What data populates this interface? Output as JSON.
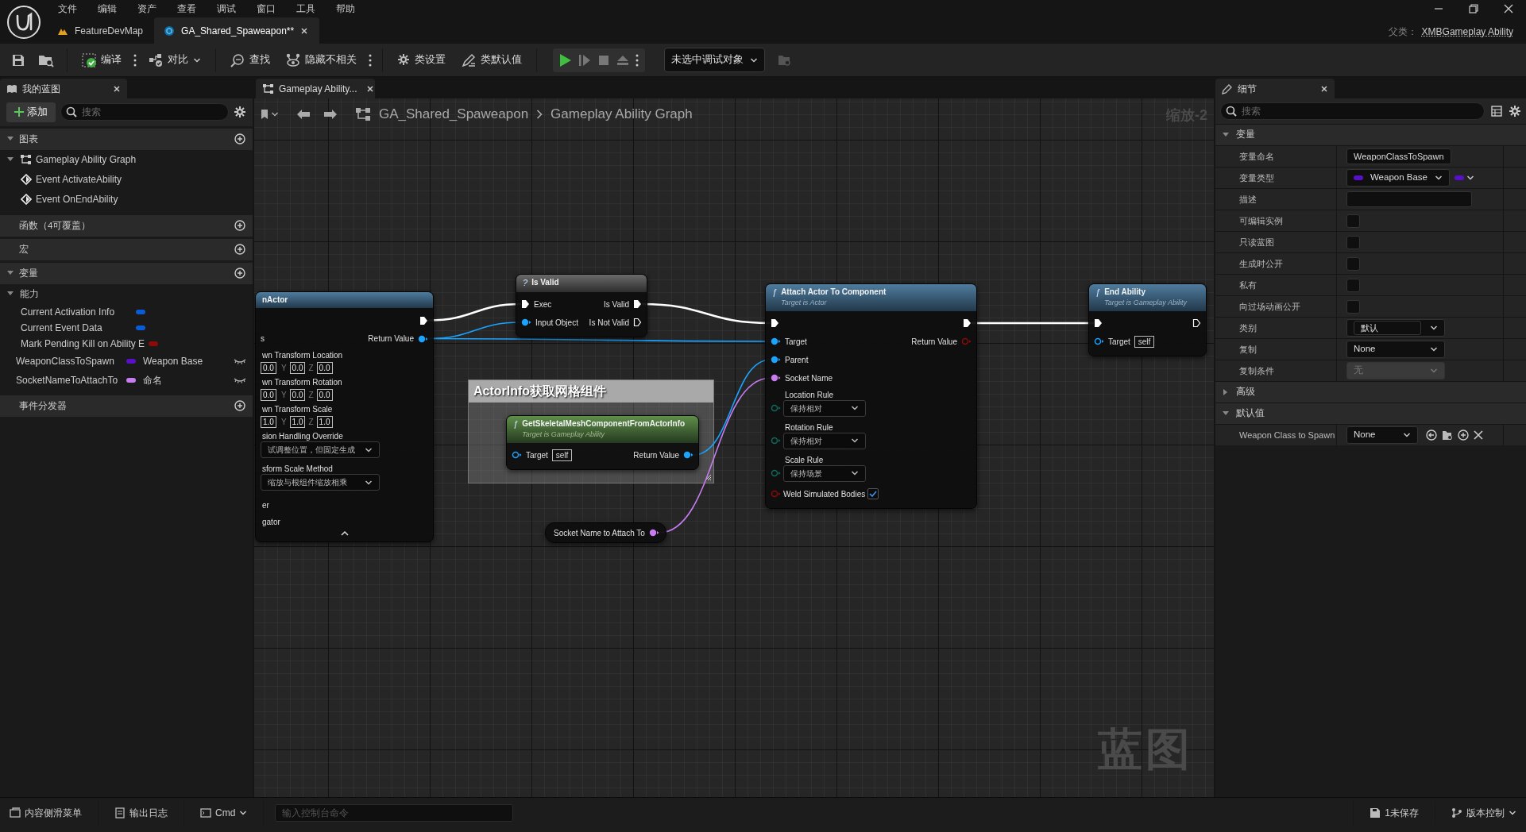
{
  "menu": [
    "文件",
    "编辑",
    "资产",
    "查看",
    "调试",
    "窗口",
    "工具",
    "帮助"
  ],
  "doc_tabs": [
    {
      "label": "FeatureDevMap",
      "selected": false
    },
    {
      "label": "GA_Shared_Spaweapon**",
      "selected": true
    }
  ],
  "parent_class": {
    "label": "父类：",
    "value": "XMBGameplay Ability"
  },
  "toolbar": [
    {
      "kind": "compile",
      "label": "编译"
    },
    {
      "kind": "diff",
      "label": "对比"
    },
    {
      "kind": "find",
      "label": "查找"
    },
    {
      "kind": "hide",
      "label": "隐藏不相关"
    },
    {
      "kind": "settings",
      "label": "类设置"
    },
    {
      "kind": "defaults",
      "label": "类默认值"
    }
  ],
  "debug_target": "未选中调试对象",
  "my_blueprint": {
    "tab": "我的蓝图",
    "add_button": "添加",
    "search_placeholder": "搜索",
    "sections": [
      {
        "title": "图表",
        "expanded": true,
        "items": [
          {
            "label": "Gameplay Ability Graph",
            "kind": "graph",
            "expanded": true,
            "children": [
              {
                "label": "Event ActivateAbility",
                "kind": "event"
              },
              {
                "label": "Event OnEndAbility",
                "kind": "event"
              }
            ]
          }
        ]
      },
      {
        "title": "函数（4可覆盖）"
      },
      {
        "title": "宏"
      },
      {
        "title": "变量",
        "expanded": true,
        "items": [
          {
            "label": "能力",
            "kind": "category",
            "expanded": true,
            "children": [
              {
                "label": "Current Activation Info",
                "kind": "variable",
                "color": "#0a5bd6"
              },
              {
                "label": "Current Event Data",
                "kind": "variable",
                "color": "#0a5bd6"
              },
              {
                "label": "Mark Pending Kill on Ability E",
                "kind": "variable",
                "color": "#8b0a0a"
              }
            ]
          },
          {
            "label": "WeaponClassToSpawn",
            "kind": "variable",
            "color": "#5a0fc8",
            "type": "Weapon Base",
            "exposed": false
          },
          {
            "label": "SocketNameToAttachTo",
            "kind": "variable",
            "color": "#c77df0",
            "type": "命名",
            "exposed": false
          }
        ]
      },
      {
        "title": "事件分发器"
      }
    ]
  },
  "graph": {
    "tab": "Gameplay Ability...",
    "breadcrumb": [
      "GA_Shared_Spaweapon",
      "Gameplay Ability Graph"
    ],
    "zoom": "缩放-2",
    "watermark": "蓝图",
    "nodes": [
      {
        "kind": "function",
        "title": "nActor",
        "collapsible": true,
        "rows": [
          {
            "kind": "pins",
            "out": {
              "kind": "exec",
              "connected": true
            }
          },
          {
            "kind": "pins",
            "in": {
              "label": "s"
            },
            "out": {
              "kind": "data",
              "label": "Return Value",
              "color": "#1aa3ff",
              "connected": true
            }
          },
          {
            "kind": "vector",
            "label": "wn Transform Location",
            "values": [
              {
                "value": "0.0"
              },
              {
                "axis": "Y",
                "value": "0.0"
              },
              {
                "axis": "Z",
                "value": "0.0"
              }
            ]
          },
          {
            "kind": "vector",
            "label": "wn Transform Rotation",
            "values": [
              {
                "value": "0.0"
              },
              {
                "axis": "Y",
                "value": "0.0"
              },
              {
                "axis": "Z",
                "value": "0.0"
              }
            ]
          },
          {
            "kind": "vector",
            "label": "wn Transform Scale",
            "values": [
              {
                "value": "1.0"
              },
              {
                "axis": "Y",
                "value": "1.0"
              },
              {
                "axis": "Z",
                "value": "1.0"
              }
            ]
          },
          {
            "kind": "enum",
            "label": "sion Handling Override",
            "value": "试调整位置，但固定生成"
          },
          {
            "kind": "enum",
            "label": "sform Scale Method",
            "value": "缩放与根组件缩放相乘"
          },
          {
            "kind": "text",
            "label": "er"
          },
          {
            "kind": "text",
            "label": "gator"
          }
        ]
      },
      {
        "kind": "macro",
        "glyph": "?",
        "title": "Is Valid",
        "rows": [
          {
            "kind": "pins",
            "in": {
              "kind": "exec",
              "label": "Exec",
              "connected": true
            },
            "out": {
              "kind": "exec",
              "label": "Is Valid",
              "connected": true
            }
          },
          {
            "kind": "pins",
            "in": {
              "kind": "data",
              "label": "Input Object",
              "color": "#1aa3ff",
              "connected": true
            },
            "out": {
              "kind": "exec",
              "label": "Is Not Valid",
              "connected": false
            }
          }
        ]
      },
      {
        "kind": "comment",
        "title": "ActorInfo获取网格组件"
      },
      {
        "kind": "pure",
        "glyph": "ƒ",
        "title": "GetSkeletalMeshComponentFromActorInfo",
        "subtitle": "Target is Gameplay Ability",
        "rows": [
          {
            "kind": "pins",
            "in": {
              "kind": "data",
              "label": "Target",
              "color": "#1aa3ff",
              "connected": false,
              "default": "self"
            },
            "out": {
              "kind": "data",
              "label": "Return Value",
              "color": "#1aa3ff",
              "connected": true
            }
          }
        ]
      },
      {
        "kind": "getter",
        "rows": [
          {
            "kind": "pins",
            "out": {
              "kind": "data",
              "label": "Socket Name to Attach To",
              "color": "#c77df0",
              "connected": true
            }
          }
        ]
      },
      {
        "kind": "function",
        "glyph": "ƒ",
        "title": "Attach Actor To Component",
        "subtitle": "Target is Actor",
        "rows": [
          {
            "kind": "pins",
            "in": {
              "kind": "exec",
              "connected": true
            },
            "out": {
              "kind": "exec",
              "connected": true
            }
          },
          {
            "kind": "pins",
            "in": {
              "kind": "data",
              "label": "Target",
              "color": "#1aa3ff",
              "connected": true
            },
            "out": {
              "kind": "data",
              "label": "Return Value",
              "color": "#8b0a0a",
              "connected": false
            }
          },
          {
            "kind": "pins",
            "in": {
              "kind": "data",
              "label": "Parent",
              "color": "#1aa3ff",
              "connected": true
            }
          },
          {
            "kind": "pins",
            "in": {
              "kind": "data",
              "label": "Socket Name",
              "color": "#c77df0",
              "connected": true
            }
          },
          {
            "kind": "enum",
            "label": "Location Rule",
            "value": "保持相对",
            "pin": {
              "kind": "data",
              "color": "#0e6b5e",
              "connected": false
            }
          },
          {
            "kind": "enum",
            "label": "Rotation Rule",
            "value": "保持相对",
            "pin": {
              "kind": "data",
              "color": "#0e6b5e",
              "connected": false
            }
          },
          {
            "kind": "enum",
            "label": "Scale Rule",
            "value": "保持场景",
            "pin": {
              "kind": "data",
              "color": "#0e6b5e",
              "connected": false
            }
          },
          {
            "kind": "bool",
            "label": "Weld Simulated Bodies",
            "checked": true,
            "pin": {
              "kind": "data",
              "color": "#8b0a0a",
              "connected": false
            }
          }
        ]
      },
      {
        "kind": "function",
        "glyph": "ƒ",
        "title": "End Ability",
        "subtitle": "Target is Gameplay Ability",
        "rows": [
          {
            "kind": "pins",
            "in": {
              "kind": "exec",
              "connected": true
            },
            "out": {
              "kind": "exec",
              "connected": false
            }
          },
          {
            "kind": "pins",
            "in": {
              "kind": "data",
              "label": "Target",
              "color": "#1aa3ff",
              "connected": false,
              "default": "self"
            }
          }
        ]
      }
    ]
  },
  "details": {
    "tab": "细节",
    "search_placeholder": "搜索",
    "sections": [
      {
        "title": "变量",
        "expanded": true,
        "rows": [
          {
            "label": "变量命名",
            "kind": "text",
            "value": "WeaponClassToSpawn"
          },
          {
            "label": "变量类型",
            "kind": "type",
            "value": "Weapon Base",
            "color": "#5a0fc8"
          },
          {
            "label": "描述",
            "kind": "text"
          },
          {
            "label": "可编辑实例",
            "kind": "checkbox",
            "checked": false
          },
          {
            "label": "只读蓝图",
            "kind": "checkbox",
            "checked": false
          },
          {
            "label": "生成时公开",
            "kind": "checkbox",
            "checked": false
          },
          {
            "label": "私有",
            "kind": "checkbox",
            "checked": false
          },
          {
            "label": "向过场动画公开",
            "kind": "checkbox",
            "checked": false
          },
          {
            "label": "类别",
            "kind": "combo",
            "value": "默认"
          },
          {
            "label": "复制",
            "kind": "dropdown",
            "value": "None",
            "disabled": false
          },
          {
            "label": "复制条件",
            "kind": "dropdown",
            "value": "无",
            "disabled": true
          }
        ]
      },
      {
        "title": "高级",
        "expanded": false
      },
      {
        "title": "默认值",
        "expanded": true,
        "rows": [
          {
            "label": "Weapon Class to Spawn",
            "kind": "asset",
            "value": "None"
          }
        ]
      }
    ]
  },
  "status_bar": {
    "left": [
      {
        "kind": "drawer",
        "label": "内容侧滑菜单"
      },
      {
        "kind": "log",
        "label": "输出日志"
      },
      {
        "kind": "cmd",
        "label": "Cmd"
      }
    ],
    "console_placeholder": "输入控制台命令",
    "right": [
      {
        "kind": "save",
        "label": "1未保存"
      },
      {
        "kind": "vcs",
        "label": "版本控制"
      }
    ]
  }
}
